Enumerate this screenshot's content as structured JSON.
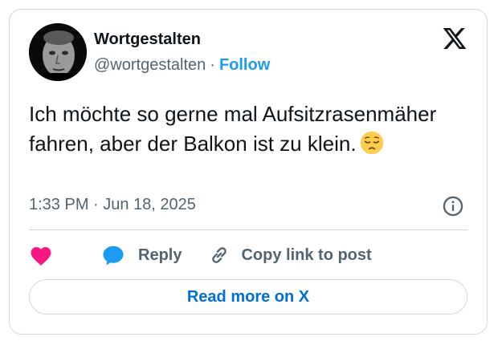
{
  "author": {
    "display_name": "Wortgestalten",
    "handle": "@wortgestalten",
    "separator": "·",
    "follow_label": "Follow"
  },
  "tweet": {
    "text": "Ich möchte so gerne mal Aufsitzrasenmäher fahren, aber der Balkon ist zu klein.",
    "emoji": "pensive-face-emoji",
    "timestamp": "1:33 PM · Jun 18, 2025"
  },
  "actions": {
    "like_icon": "heart-icon",
    "reply_label": "Reply",
    "copy_link_label": "Copy link to post"
  },
  "read_more_label": "Read more on X",
  "colors": {
    "accent": "#1d9bf0",
    "read_more": "#006fd6",
    "heart": "#f91880",
    "text_primary": "#0f1419",
    "text_secondary": "#536471",
    "border": "#cfd9de"
  }
}
